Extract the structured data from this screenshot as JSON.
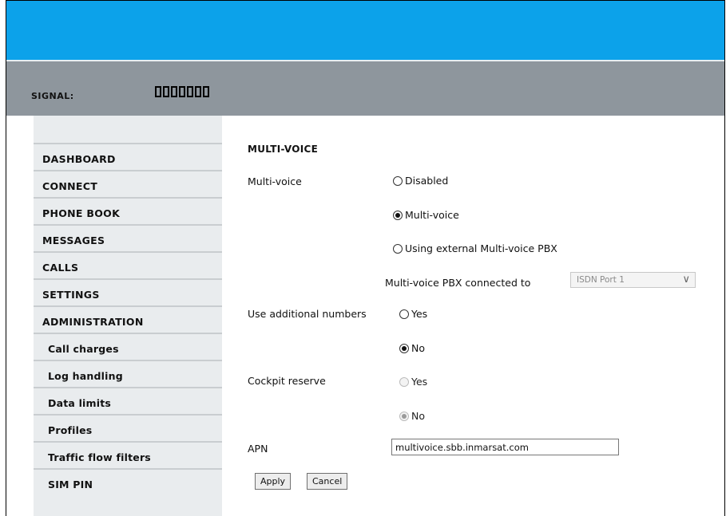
{
  "status": {
    "signal_label": "SIGNAL:",
    "signal_bars_total": 7,
    "signal_bars_filled": 0
  },
  "sidebar": {
    "items": [
      {
        "label": "DASHBOARD",
        "sub": false
      },
      {
        "label": "CONNECT",
        "sub": false
      },
      {
        "label": "PHONE BOOK",
        "sub": false
      },
      {
        "label": "MESSAGES",
        "sub": false
      },
      {
        "label": "CALLS",
        "sub": false
      },
      {
        "label": "SETTINGS",
        "sub": false
      },
      {
        "label": "ADMINISTRATION",
        "sub": false
      },
      {
        "label": "Call charges",
        "sub": true
      },
      {
        "label": "Log handling",
        "sub": true
      },
      {
        "label": "Data limits",
        "sub": true
      },
      {
        "label": "Profiles",
        "sub": true
      },
      {
        "label": "Traffic flow filters",
        "sub": true
      },
      {
        "label": "SIM PIN",
        "sub": true
      }
    ]
  },
  "main": {
    "title": "MULTI-VOICE",
    "multivoice": {
      "label": "Multi-voice",
      "options": [
        {
          "label": "Disabled",
          "checked": false
        },
        {
          "label": "Multi-voice",
          "checked": true
        },
        {
          "label": "Using external Multi-voice PBX",
          "checked": false
        }
      ]
    },
    "pbx": {
      "label": "Multi-voice PBX connected to",
      "selected": "ISDN Port 1",
      "disabled": true
    },
    "additional_numbers": {
      "label": "Use additional numbers",
      "options": [
        {
          "label": "Yes",
          "checked": false
        },
        {
          "label": "No",
          "checked": true
        }
      ]
    },
    "cockpit_reserve": {
      "label": "Cockpit reserve",
      "disabled": true,
      "options": [
        {
          "label": "Yes",
          "checked": false
        },
        {
          "label": "No",
          "checked": true
        }
      ]
    },
    "apn": {
      "label": "APN",
      "value": "multivoice.sbb.inmarsat.com"
    },
    "buttons": {
      "apply": "Apply",
      "cancel": "Cancel"
    }
  },
  "colors": {
    "header_blue": "#0ca2ea",
    "status_gray": "#8e969d",
    "sidebar_bg": "#e9ecee"
  }
}
